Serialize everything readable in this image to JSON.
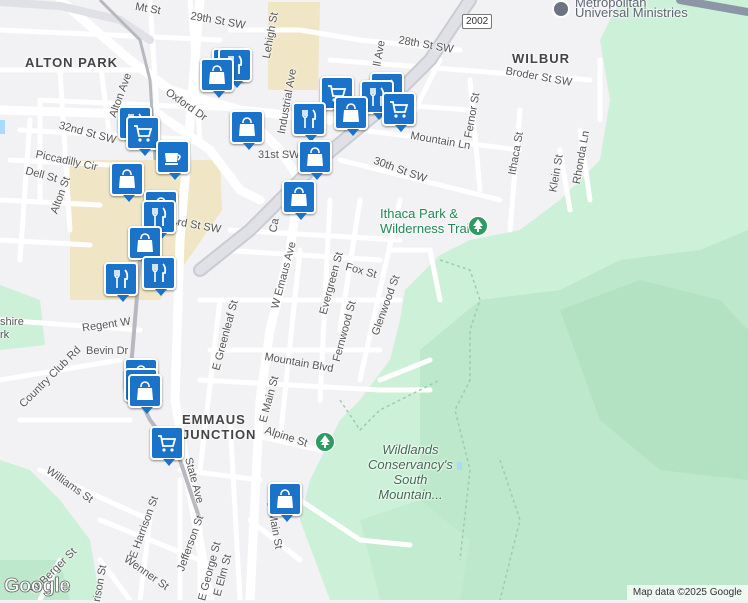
{
  "map": {
    "road_shield": "2002",
    "areas": {
      "alton_park": "ALTON PARK",
      "wilbur": "WILBUR",
      "emmaus_junction": "EMMAUS\nJUNCTION"
    },
    "parks": {
      "ithaca": "Ithaca Park &\nWilderness Trail",
      "wildlands": "Wildlands\nConservancy's\nSouth\nMountain..."
    },
    "places": {
      "universal": "Universal Ministries",
      "meteorfaith": "Metropolitan",
      "berkshire": "shire\nrk"
    },
    "streets": {
      "mt_st": "Mt St",
      "st29": "29th St SW",
      "st28": "28th St SW",
      "broder": "Broder St SW",
      "lehigh": "Lehigh St",
      "alton_ave": "Alton Ave",
      "oxford": "Oxford Dr",
      "st32": "32nd St SW",
      "st31": "31st SW",
      "piccadilly": "Piccadilly Cir",
      "dell": "Dell St",
      "alton_st": "Alton St",
      "st33": "33rd St SW",
      "industrial": "Industrial Ave",
      "hill_ave": "ll Ave",
      "mountain_ln": "Mountain Ln",
      "fernor": "Fernor St",
      "ithaca": "Ithaca St",
      "klein": "Klein St",
      "rhonda": "Rhonda Ln",
      "st30": "30th St SW",
      "w_emaus": "W Emaus Ave",
      "evergreen": "Evergreen St",
      "fox": "Fox St",
      "glenwood": "Glenwood St",
      "fernwood": "Fernwood St",
      "greenleaf": "E Greenleaf St",
      "regent": "Regent W",
      "bevin": "Bevin Dr",
      "country_club": "Country Club Rd",
      "mountain_blvd": "Mountain Blvd",
      "e_main": "E Main St",
      "alpine": "Alpine St",
      "state_ave": "State Ave",
      "williams": "Williams St",
      "e_harrison": "E Harrison St",
      "harrison": "rison St",
      "w_berger": "W Berger St",
      "jefferson": "Jefferson St",
      "e_george": "E George St",
      "e_elm": "E Elm St",
      "wenner": "Wenner St",
      "e_main2": "E Main St",
      "c_st": "Ca"
    },
    "icons": [
      "shopping-bag-icon",
      "restaurant-icon",
      "grocery-cart-icon",
      "cafe-icon",
      "park-tree-icon"
    ],
    "colors": {
      "park_green": "#cdf0d9",
      "park_dark": "#b9e6c8",
      "road": "#ffffff",
      "highway": "#d1d4da",
      "pin": "#1a73c9",
      "water": "#aadaff",
      "campus": "#f0e5c4"
    }
  },
  "attribution": "Map data ©2025 Google",
  "logo": "Google"
}
